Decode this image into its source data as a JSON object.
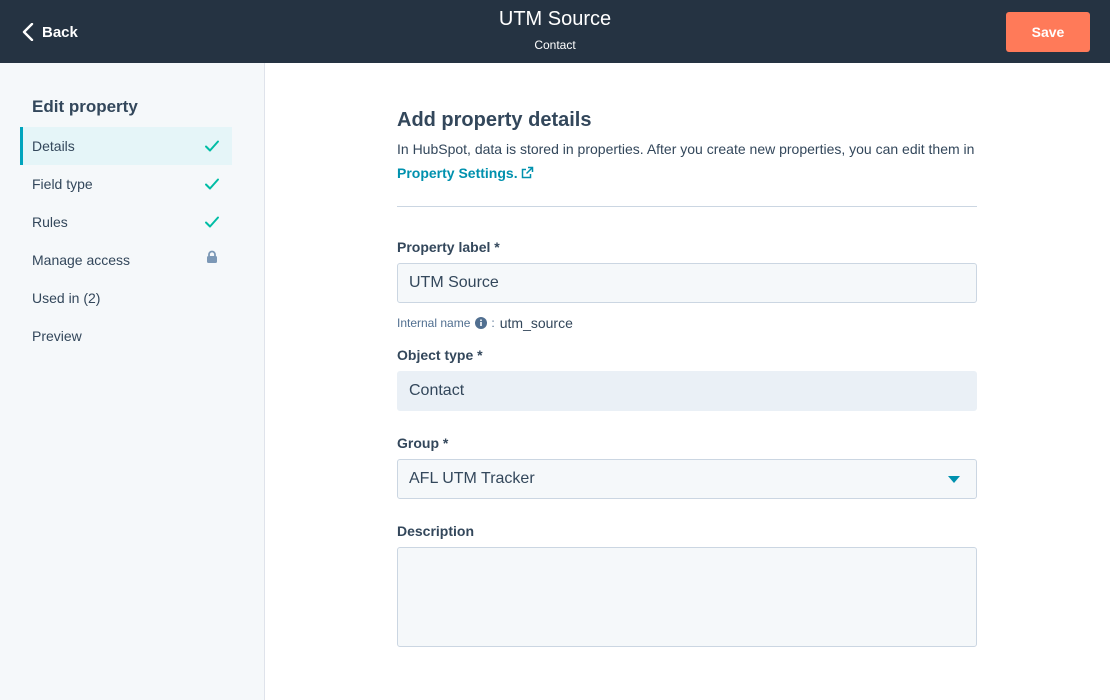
{
  "header": {
    "back_label": "Back",
    "title": "UTM Source",
    "subtitle": "Contact",
    "save_label": "Save"
  },
  "sidebar": {
    "heading": "Edit property",
    "items": [
      {
        "label": "Details",
        "status": "check-icon",
        "active": true
      },
      {
        "label": "Field type",
        "status": "check-icon"
      },
      {
        "label": "Rules",
        "status": "check-icon"
      },
      {
        "label": "Manage access",
        "status": "lock-icon"
      },
      {
        "label": "Used in (2)",
        "status": ""
      },
      {
        "label": "Preview",
        "status": ""
      }
    ]
  },
  "main": {
    "section_title": "Add property details",
    "intro_text": "In HubSpot, data is stored in properties. After you create new properties, you can edit them in",
    "intro_link": "Property Settings.",
    "property_label": {
      "label": "Property label *",
      "value": "UTM Source"
    },
    "internal_name": {
      "label": "Internal name",
      "value": "utm_source"
    },
    "object_type": {
      "label": "Object type *",
      "value": "Contact"
    },
    "group": {
      "label": "Group *",
      "value": "AFL UTM Tracker"
    },
    "description": {
      "label": "Description",
      "value": ""
    }
  },
  "colors": {
    "header_bg": "#253342",
    "accent": "#00a4bd",
    "link": "#0091ae",
    "save_button": "#ff7a59",
    "check": "#00bda5"
  }
}
